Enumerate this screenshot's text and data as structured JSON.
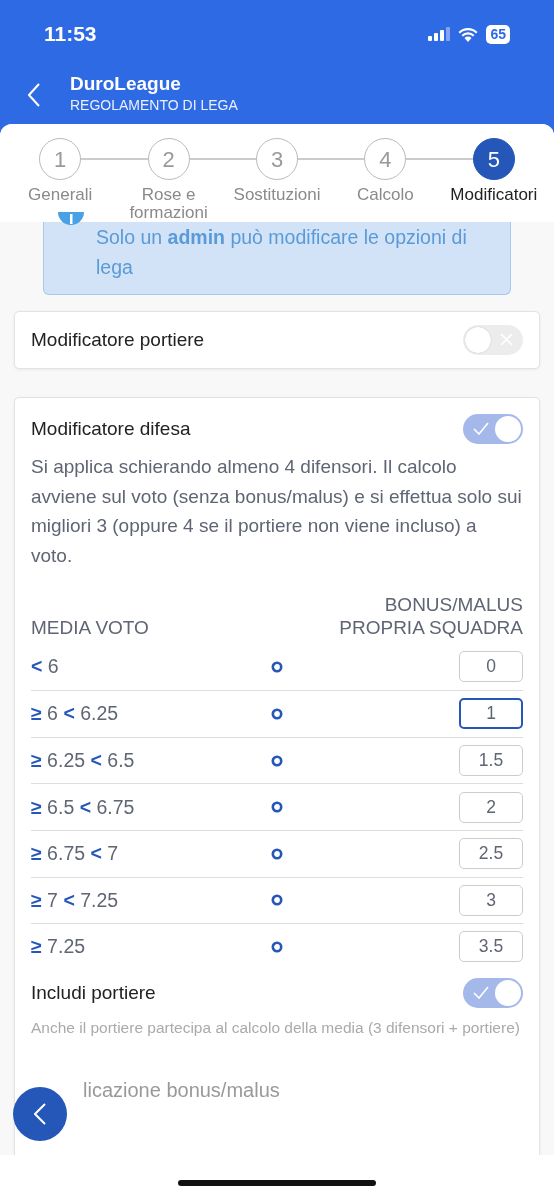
{
  "status_bar": {
    "time": "11:53",
    "battery": "65"
  },
  "header": {
    "title": "DuroLeague",
    "subtitle": "REGOLAMENTO DI LEGA"
  },
  "steps": [
    {
      "number": "1",
      "label": "Generali",
      "selected": false
    },
    {
      "number": "2",
      "label": "Rose e formazioni",
      "selected": false
    },
    {
      "number": "3",
      "label": "Sostituzioni",
      "selected": false
    },
    {
      "number": "4",
      "label": "Calcolo",
      "selected": false
    },
    {
      "number": "5",
      "label": "Modificatori",
      "selected": true
    }
  ],
  "notice": {
    "text": "Solo un **admin** può modificare le opzioni di lega"
  },
  "goalkeeper_modifier": {
    "title": "Modificatore portiere",
    "on": false
  },
  "defense_modifier": {
    "title": "Modificatore difesa",
    "on": true,
    "description": "Si applica schierando almeno 4 difensori. Il calcolo avviene sul voto (senza bonus/malus) e si effettua solo sui migliori 3 (oppure 4 se il portiere non viene incluso) a voto.",
    "columns": [
      "MEDIA VOTO",
      "BONUS/MALUS PROPRIA SQUADRA"
    ],
    "rows": [
      {
        "bounds": [
          {
            "op": "<",
            "value": "6"
          }
        ],
        "bonus": "0",
        "focused": false
      },
      {
        "bounds": [
          {
            "op": "≥",
            "value": "6"
          },
          {
            "op": "<",
            "value": "6.25"
          }
        ],
        "bonus": "1",
        "focused": true
      },
      {
        "bounds": [
          {
            "op": "≥",
            "value": "6.25"
          },
          {
            "op": "<",
            "value": "6.5"
          }
        ],
        "bonus": "1.5",
        "focused": false
      },
      {
        "bounds": [
          {
            "op": "≥",
            "value": "6.5"
          },
          {
            "op": "<",
            "value": "6.75"
          }
        ],
        "bonus": "2",
        "focused": false
      },
      {
        "bounds": [
          {
            "op": "≥",
            "value": "6.75"
          },
          {
            "op": "<",
            "value": "7"
          }
        ],
        "bonus": "2.5",
        "focused": false
      },
      {
        "bounds": [
          {
            "op": "≥",
            "value": "7"
          },
          {
            "op": "<",
            "value": "7.25"
          }
        ],
        "bonus": "3",
        "focused": false
      },
      {
        "bounds": [
          {
            "op": "≥",
            "value": "7.25"
          }
        ],
        "bonus": "3.5",
        "focused": false
      }
    ],
    "include_goalkeeper": {
      "title": "Includi portiere",
      "on": true,
      "hint": "Anche il portiere partecipa al calcolo della media (3 difensori + portiere)"
    },
    "next_section": "licazione bonus/malus"
  }
}
